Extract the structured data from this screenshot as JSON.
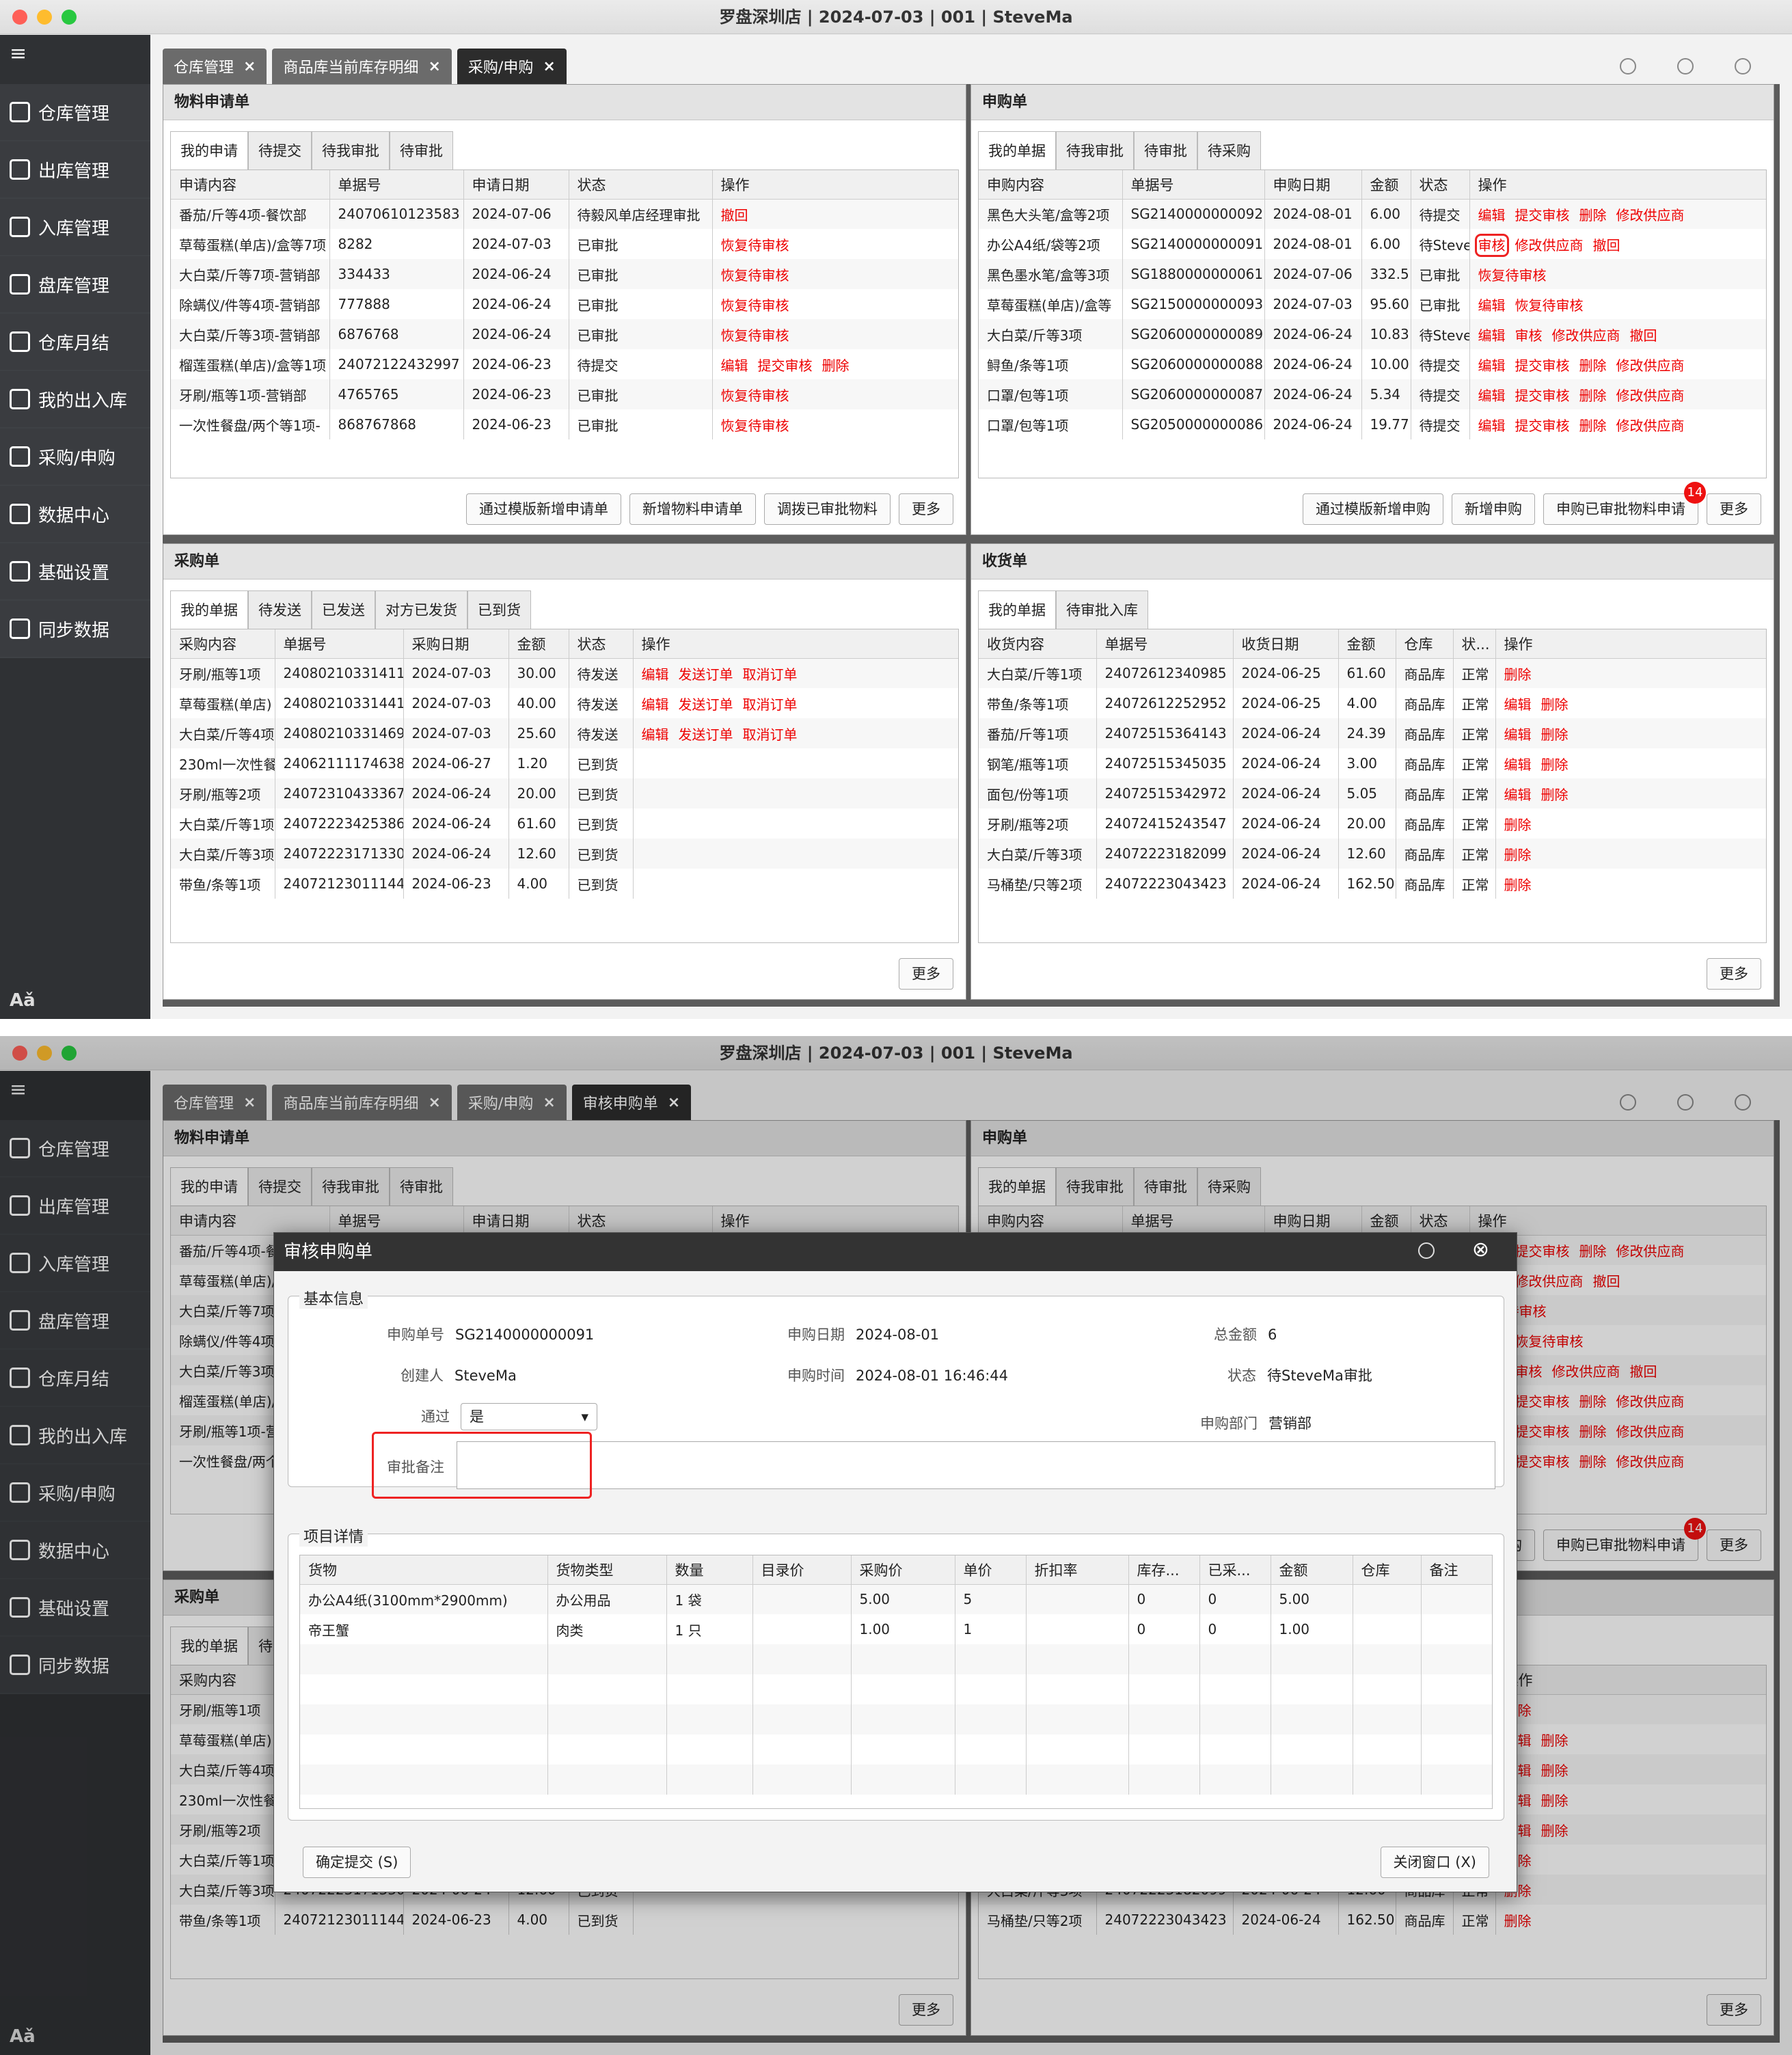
{
  "window": {
    "title": "罗盘深圳店 | 2024-07-03 | 001 | SteveMa"
  },
  "nav": [
    "仓库管理",
    "出库管理",
    "入库管理",
    "盘库管理",
    "仓库月结",
    "我的出入库",
    "采购/申购",
    "数据中心",
    "基础设置",
    "同步数据"
  ],
  "font_toggle": "Aǎ",
  "tabs1": [
    "仓库管理",
    "商品库当前库存明细",
    "采购/申购"
  ],
  "tabs2": [
    "仓库管理",
    "商品库当前库存明细",
    "采购/申购",
    "审核申购单"
  ],
  "p1": {
    "title": "物料申请单",
    "subtabs": [
      "我的申请",
      "待提交",
      "待我审批",
      "待审批"
    ],
    "cols": [
      "申请内容",
      "单据号",
      "申请日期",
      "状态",
      "操作"
    ],
    "rows": [
      [
        "番茄/斤等4项-餐饮部",
        "24070610123583",
        "2024-07-06",
        "待毅风单店经理审批",
        "撤回"
      ],
      [
        "草莓蛋糕(单店)/盒等7项",
        "8282",
        "2024-07-03",
        "已审批",
        "恢复待审核"
      ],
      [
        "大白菜/斤等7项-营销部",
        "334433",
        "2024-06-24",
        "已审批",
        "恢复待审核"
      ],
      [
        "除螨仪/件等4项-营销部",
        "777888",
        "2024-06-24",
        "已审批",
        "恢复待审核"
      ],
      [
        "大白菜/斤等3项-营销部",
        "6876768",
        "2024-06-24",
        "已审批",
        "恢复待审核"
      ],
      [
        "榴莲蛋糕(单店)/盒等1项",
        "24072122432997",
        "2024-06-23",
        "待提交",
        "编辑 提交审核 删除"
      ],
      [
        "牙刷/瓶等1项-营销部",
        "4765765",
        "2024-06-23",
        "已审批",
        "恢复待审核"
      ],
      [
        "一次性餐盘/两个等1项-",
        "868767868",
        "2024-06-23",
        "已审批",
        "恢复待审核"
      ]
    ],
    "buttons": [
      "通过模版新增申请单",
      "新增物料申请单",
      "调拨已审批物料",
      "更多"
    ]
  },
  "p2": {
    "title": "申购单",
    "subtabs": [
      "我的单据",
      "待我审批",
      "待审批",
      "待采购"
    ],
    "cols": [
      "申购内容",
      "单据号",
      "申购日期",
      "金额",
      "状态",
      "操作"
    ],
    "rows": [
      [
        "黑色大头笔/盒等2项",
        "SG2140000000092",
        "2024-08-01",
        "6.00",
        "待提交",
        "编辑 提交审核 删除 修改供应商"
      ],
      [
        "办公A4纸/袋等2项",
        "SG2140000000091",
        "2024-08-01",
        "6.00",
        "待Steve",
        "审核 修改供应商 撤回"
      ],
      [
        "黑色墨水笔/盒等3项",
        "SG1880000000061",
        "2024-07-06",
        "332.5",
        "已审批",
        "恢复待审核"
      ],
      [
        "草莓蛋糕(单店)/盒等",
        "SG2150000000093",
        "2024-07-03",
        "95.60",
        "已审批",
        "编辑 恢复待审核"
      ],
      [
        "大白菜/斤等3项",
        "SG2060000000089",
        "2024-06-24",
        "10.83",
        "待Steve",
        "编辑 审核 修改供应商 撤回"
      ],
      [
        "鲟鱼/条等1项",
        "SG2060000000088",
        "2024-06-24",
        "10.00",
        "待提交",
        "编辑 提交审核 删除 修改供应商"
      ],
      [
        "口罩/包等1项",
        "SG2060000000087",
        "2024-06-24",
        "5.34",
        "待提交",
        "编辑 提交审核 删除 修改供应商"
      ],
      [
        "口罩/包等1项",
        "SG2050000000086",
        "2024-06-24",
        "19.77",
        "待提交",
        "编辑 提交审核 删除 修改供应商"
      ]
    ],
    "buttons": [
      "通过模版新增申购",
      "新增申购",
      "申购已审批物料申请",
      "更多"
    ],
    "badge": "14"
  },
  "p3": {
    "title": "采购单",
    "subtabs": [
      "我的单据",
      "待发送",
      "已发送",
      "对方已发货",
      "已到货"
    ],
    "cols": [
      "采购内容",
      "单据号",
      "采购日期",
      "金额",
      "状态",
      "操作"
    ],
    "rows": [
      [
        "牙刷/瓶等1项",
        "24080210331411",
        "2024-07-03",
        "30.00",
        "待发送",
        "编辑 发送订单 取消订单"
      ],
      [
        "草莓蛋糕(单店)",
        "24080210331441",
        "2024-07-03",
        "40.00",
        "待发送",
        "编辑 发送订单 取消订单"
      ],
      [
        "大白菜/斤等4项",
        "24080210331469",
        "2024-07-03",
        "25.60",
        "待发送",
        "编辑 发送订单 取消订单"
      ],
      [
        "230ml一次性餐",
        "24062111174638",
        "2024-06-27",
        "1.20",
        "已到货",
        ""
      ],
      [
        "牙刷/瓶等2项",
        "24072310433367",
        "2024-06-24",
        "20.00",
        "已到货",
        ""
      ],
      [
        "大白菜/斤等1项",
        "24072223425386",
        "2024-06-24",
        "61.60",
        "已到货",
        ""
      ],
      [
        "大白菜/斤等3项",
        "24072223171330",
        "2024-06-24",
        "12.60",
        "已到货",
        ""
      ],
      [
        "带鱼/条等1项",
        "24072123011144",
        "2024-06-23",
        "4.00",
        "已到货",
        ""
      ]
    ],
    "buttons": [
      "更多"
    ]
  },
  "p4": {
    "title": "收货单",
    "subtabs": [
      "我的单据",
      "待审批入库"
    ],
    "cols": [
      "收货内容",
      "单据号",
      "收货日期",
      "金额",
      "仓库",
      "状...",
      "操作"
    ],
    "rows": [
      [
        "大白菜/斤等1项",
        "24072612340985",
        "2024-06-25",
        "61.60",
        "商品库",
        "正常",
        "删除"
      ],
      [
        "带鱼/条等1项",
        "24072612252952",
        "2024-06-25",
        "4.00",
        "商品库",
        "正常",
        "编辑 删除"
      ],
      [
        "番茄/斤等1项",
        "24072515364143",
        "2024-06-24",
        "24.39",
        "商品库",
        "正常",
        "编辑 删除"
      ],
      [
        "钢笔/瓶等1项",
        "24072515345035",
        "2024-06-24",
        "3.00",
        "商品库",
        "正常",
        "编辑 删除"
      ],
      [
        "面包/份等1项",
        "24072515342972",
        "2024-06-24",
        "5.05",
        "商品库",
        "正常",
        "编辑 删除"
      ],
      [
        "牙刷/瓶等2项",
        "24072415243547",
        "2024-06-24",
        "20.00",
        "商品库",
        "正常",
        "删除"
      ],
      [
        "大白菜/斤等3项",
        "24072223182099",
        "2024-06-24",
        "12.60",
        "商品库",
        "正常",
        "删除"
      ],
      [
        "马桶垫/只等2项",
        "24072223043423",
        "2024-06-24",
        "162.50",
        "商品库",
        "正常",
        "删除"
      ]
    ],
    "buttons": [
      "更多"
    ]
  },
  "dialog": {
    "title": "审核申购单",
    "basic_label": "基本信息",
    "items_label": "项目详情",
    "fields": {
      "no_k": "申购单号",
      "no_v": "SG2140000000091",
      "date_k": "申购日期",
      "date_v": "2024-08-01",
      "total_k": "总金额",
      "total_v": "6",
      "creator_k": "创建人",
      "creator_v": "SteveMa",
      "time_k": "申购时间",
      "time_v": "2024-08-01 16:46:44",
      "status_k": "状态",
      "status_v": "待SteveMa审批",
      "pass_k": "通过",
      "pass_v": "是",
      "dept_k": "申购部门",
      "dept_v": "营销部",
      "remark_k": "审批备注"
    },
    "cols": [
      "货物",
      "货物类型",
      "数量",
      "目录价",
      "采购价",
      "单价",
      "折扣率",
      "库存...",
      "已采...",
      "金额",
      "仓库",
      "备注"
    ],
    "rows": [
      [
        "办公A4纸(3100mm*2900mm)",
        "办公用品",
        "1 袋",
        "",
        "5.00",
        "5",
        "",
        "0",
        "0",
        "5.00",
        "",
        ""
      ],
      [
        "帝王蟹",
        "肉类",
        "1 只",
        "",
        "1.00",
        "1",
        "",
        "0",
        "0",
        "1.00",
        "",
        ""
      ]
    ],
    "submit": "确定提交 (S)",
    "close": "关闭窗口 (X)"
  }
}
